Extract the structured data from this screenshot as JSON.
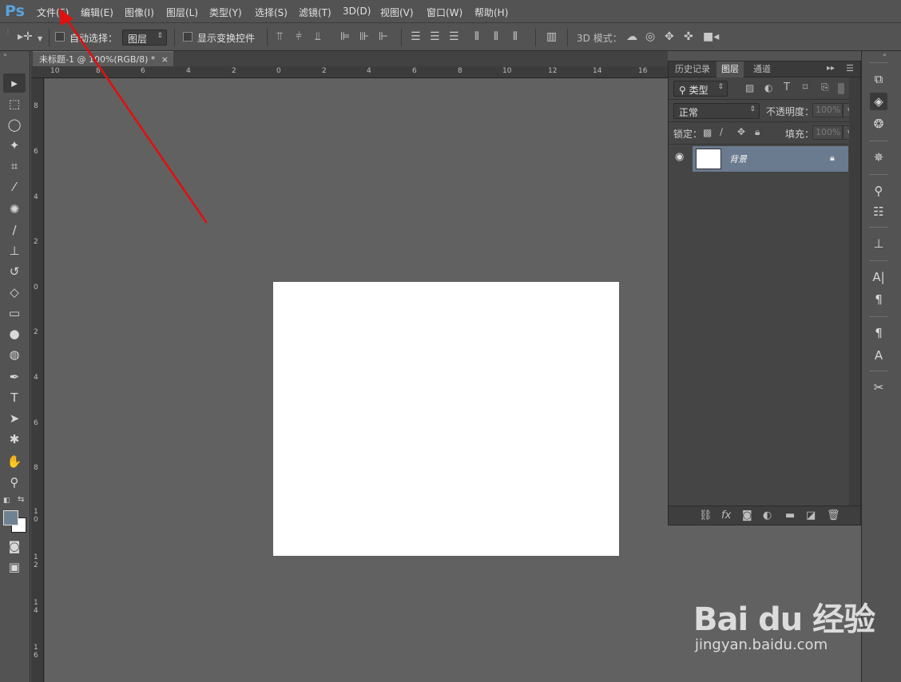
{
  "app": {
    "logo": "Ps"
  },
  "menu": [
    "文件(F)",
    "编辑(E)",
    "图像(I)",
    "图层(L)",
    "类型(Y)",
    "选择(S)",
    "滤镜(T)",
    "3D(D)",
    "视图(V)",
    "窗口(W)",
    "帮助(H)"
  ],
  "options": {
    "auto_select_label": "自动选择：",
    "auto_select_value": "图层",
    "show_transform_label": "显示变换控件",
    "mode_3d_label": "3D 模式："
  },
  "document": {
    "tab_title": "未标题-1 @ 100%(RGB/8) *",
    "tab_close": "×"
  },
  "rulers": {
    "top": [
      "10",
      "8",
      "6",
      "4",
      "2",
      "0",
      "2",
      "4",
      "6",
      "8",
      "10",
      "12",
      "14",
      "16"
    ],
    "left": [
      "8",
      "6",
      "4",
      "2",
      "0",
      "2",
      "4",
      "6",
      "8",
      "1 0",
      "1 2",
      "1 4",
      "1 6"
    ]
  },
  "panel": {
    "tabs": [
      "历史记录",
      "图层",
      "通道"
    ],
    "active_tab": "图层",
    "filter_label": "类型",
    "blend_mode": "正常",
    "opacity_label": "不透明度：",
    "opacity_value": "100%",
    "lock_label": "锁定：",
    "fill_label": "填充：",
    "fill_value": "100%",
    "layers": [
      {
        "name": "背景",
        "visible": true,
        "locked": true
      }
    ]
  },
  "watermark": {
    "main": "Bai du 经验",
    "sub": "jingyan.baidu.com"
  },
  "colors": {
    "foreground": "#6f8291",
    "background": "#ffffff",
    "annotation_arrow": "#e01010",
    "selected_layer": "#6a7a8f"
  }
}
